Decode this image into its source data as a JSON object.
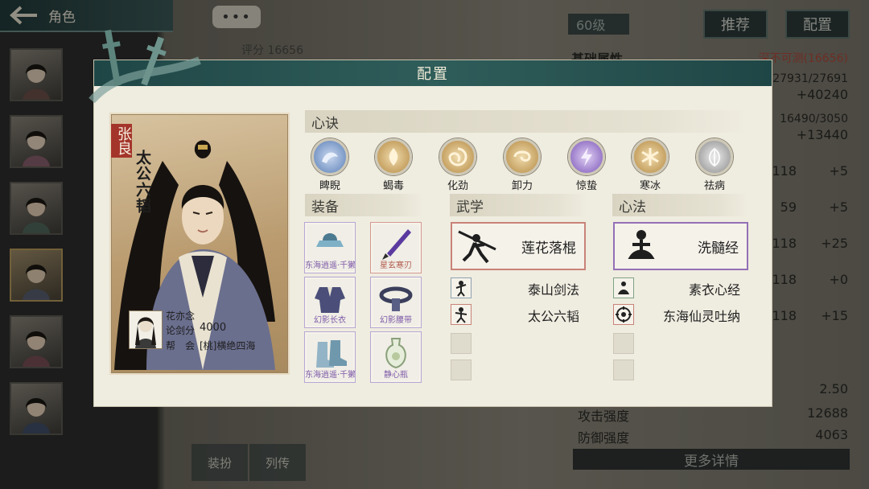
{
  "topbar": {
    "title": "角色"
  },
  "chat": {
    "label": "•••"
  },
  "level_badge": "60级",
  "buttons": {
    "recommend": "推荐",
    "config": "配置"
  },
  "score_tag": "评分 16656",
  "bg_stats": {
    "header": "基础属性",
    "rating": "深不可测(16656)",
    "rows": [
      "27931/27691",
      "+40240",
      "16490/3050",
      "+13440",
      "118",
      "+5",
      "59",
      "+5",
      "118",
      "+25",
      "118",
      "+0",
      "118",
      "+15"
    ],
    "crit": "2.50",
    "attack_label": "攻击强度",
    "attack": "12688",
    "defense_label": "防御强度",
    "defense": "4063",
    "more": "更多详情"
  },
  "bottom_nav": {
    "outfit": "装扮",
    "bio": "列传"
  },
  "modal": {
    "title": "配置",
    "character": {
      "name": "张良",
      "book": "太公六韬"
    },
    "player": {
      "name": "花亦念",
      "score_label": "论剑分",
      "score": "4000",
      "guild_label": "帮　会",
      "guild": "[桃]横绝四海"
    },
    "xinjue": {
      "header": "心诀",
      "items": [
        {
          "label": "睥睨",
          "icon": "dragon-icon",
          "color": "#5a7fb6"
        },
        {
          "label": "蝎毒",
          "icon": "flame-icon",
          "color": "#b58a43"
        },
        {
          "label": "化劲",
          "icon": "vortex-icon",
          "color": "#b58a43"
        },
        {
          "label": "卸力",
          "icon": "swirl-icon",
          "color": "#b58a43"
        },
        {
          "label": "惊蛰",
          "icon": "lightning-icon",
          "color": "#7b55b8"
        },
        {
          "label": "寒冰",
          "icon": "snowflake-icon",
          "color": "#b58a43"
        },
        {
          "label": "祛病",
          "icon": "leaf-icon",
          "color": "#8b8b8b"
        }
      ]
    },
    "equipment": {
      "header": "装备",
      "items": [
        {
          "label": "东海逍遥·千獭",
          "icon": "hat-icon"
        },
        {
          "label": "星玄寒刃",
          "icon": "blade-icon"
        },
        {
          "label": "幻影长衣",
          "icon": "robe-icon"
        },
        {
          "label": "幻影腰带",
          "icon": "belt-icon"
        },
        {
          "label": "东海逍遥·千獭",
          "icon": "boots-icon"
        },
        {
          "label": "静心瓶",
          "icon": "vase-icon"
        }
      ]
    },
    "wuxue": {
      "header": "武学",
      "main": "莲花落棍",
      "subs": [
        "泰山剑法",
        "太公六韬"
      ]
    },
    "xinfa": {
      "header": "心法",
      "main": "洗髓经",
      "subs": [
        "素衣心经",
        "东海仙灵吐纳"
      ]
    }
  }
}
